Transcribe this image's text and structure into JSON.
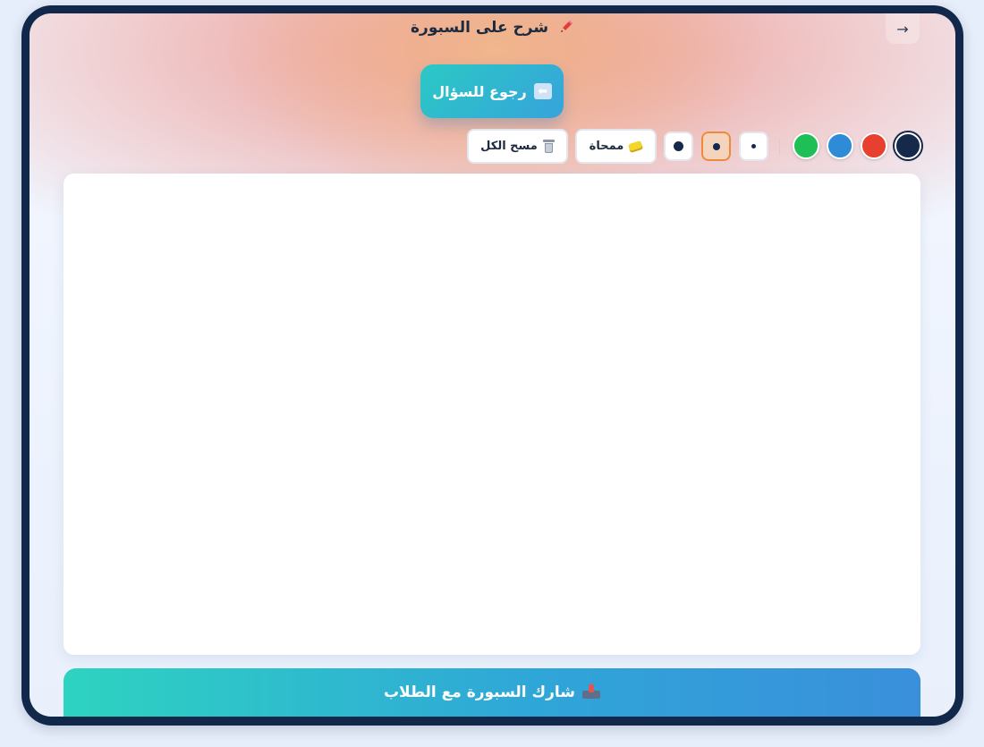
{
  "header": {
    "title": "شرح على السبورة",
    "title_icon": "pencil-icon",
    "corner_icon": "arrow-right-icon",
    "corner_glyph": "→"
  },
  "back_button": {
    "label": "رجوع للسؤال",
    "icon": "left-arrow-icon",
    "glyph": "⬅"
  },
  "toolbar": {
    "colors": [
      {
        "name": "navy",
        "hex": "#15294a",
        "selected": true
      },
      {
        "name": "red",
        "hex": "#e8402f",
        "selected": false
      },
      {
        "name": "blue",
        "hex": "#2f8bd6",
        "selected": false
      },
      {
        "name": "green",
        "hex": "#1fbf57",
        "selected": false
      }
    ],
    "sizes": [
      {
        "name": "small",
        "active": false
      },
      {
        "name": "medium",
        "active": true
      },
      {
        "name": "large",
        "active": false
      }
    ],
    "eraser_label": "ممحاة",
    "eraser_icon": "sponge-icon",
    "clear_label": "مسح الكل",
    "clear_icon": "trash-icon"
  },
  "share_button": {
    "label": "شارك السبورة مع الطلاب",
    "icon": "inbox-tray-icon"
  },
  "colors": {
    "frame": "#11284a",
    "accent_start": "#2bc9c4",
    "accent_end": "#36a3dc",
    "active_size_border": "#ef8a3c"
  }
}
